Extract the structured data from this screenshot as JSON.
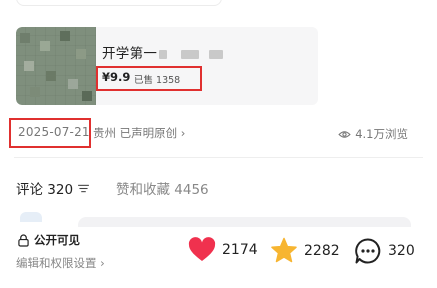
{
  "product": {
    "title": "开学第一",
    "price": "¥9.9",
    "sold": "已售 1358"
  },
  "meta": {
    "date": "2025-07-21",
    "location": "贵州 已声明原创 ›",
    "views": "4.1万浏览"
  },
  "tabs": {
    "comments_label": "评论 320",
    "likes_label": "赞和收藏 4456"
  },
  "footer": {
    "visibility": "公开可见",
    "edit_link": "编辑和权限设置 ›",
    "likes": "2174",
    "stars": "2282",
    "comments": "320"
  },
  "colors": {
    "heart": "#f0314e",
    "star": "#f7b531",
    "highlight_box": "#e0302f"
  },
  "icons": [
    "eye-icon",
    "sort-lines-icon",
    "lock-icon",
    "heart-icon",
    "star-icon",
    "comment-bubble-icon"
  ]
}
